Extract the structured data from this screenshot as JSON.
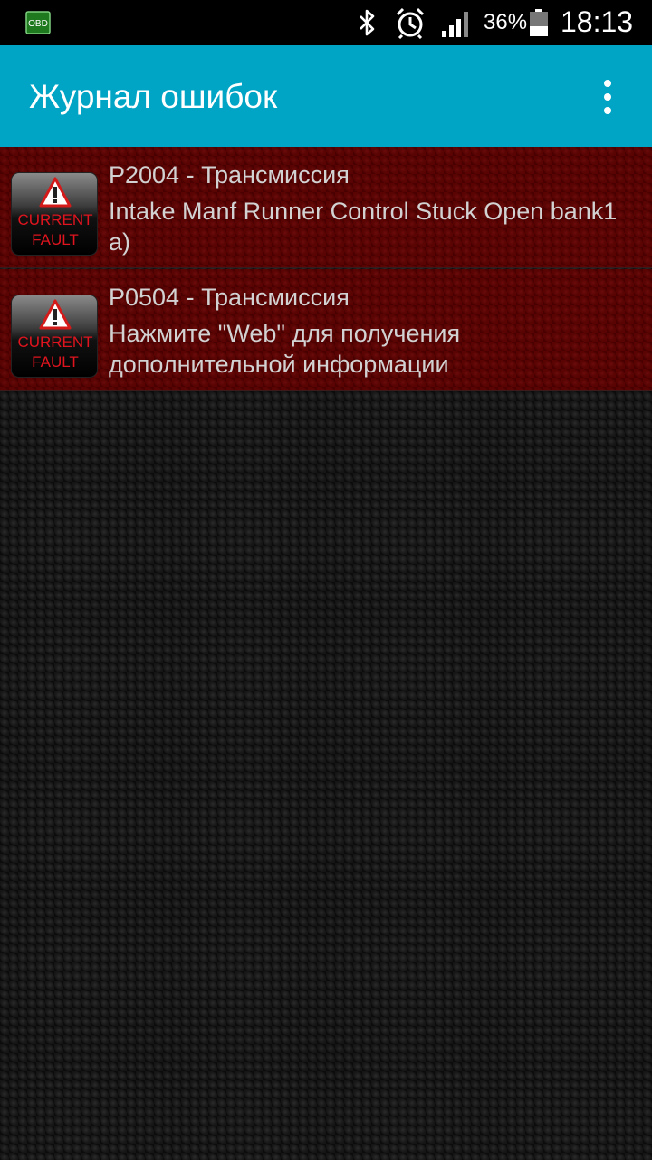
{
  "status_bar": {
    "obd_label": "OBD",
    "battery_percent": "36%",
    "time": "18:13",
    "icons": [
      "obd-icon",
      "bluetooth-icon",
      "alarm-icon",
      "signal-icon",
      "battery-icon"
    ]
  },
  "app_bar": {
    "title": "Журнал ошибок",
    "menu_icon": "overflow-menu-icon",
    "color": "#00a5c6"
  },
  "faults": [
    {
      "code": "P2004 - Трансмиссия",
      "description": "Intake Manf Runner Control Stuck Open bank1 a)",
      "badge_line1": "CURRENT",
      "badge_line2": "FAULT"
    },
    {
      "code": "P0504 - Трансмиссия",
      "description": "Нажмите \"Web\" для получения дополнительной информации",
      "badge_line1": "CURRENT",
      "badge_line2": "FAULT"
    }
  ],
  "colors": {
    "fault_row_bg": "#5a0303",
    "badge_text": "#e0141e",
    "background": "#151515"
  }
}
